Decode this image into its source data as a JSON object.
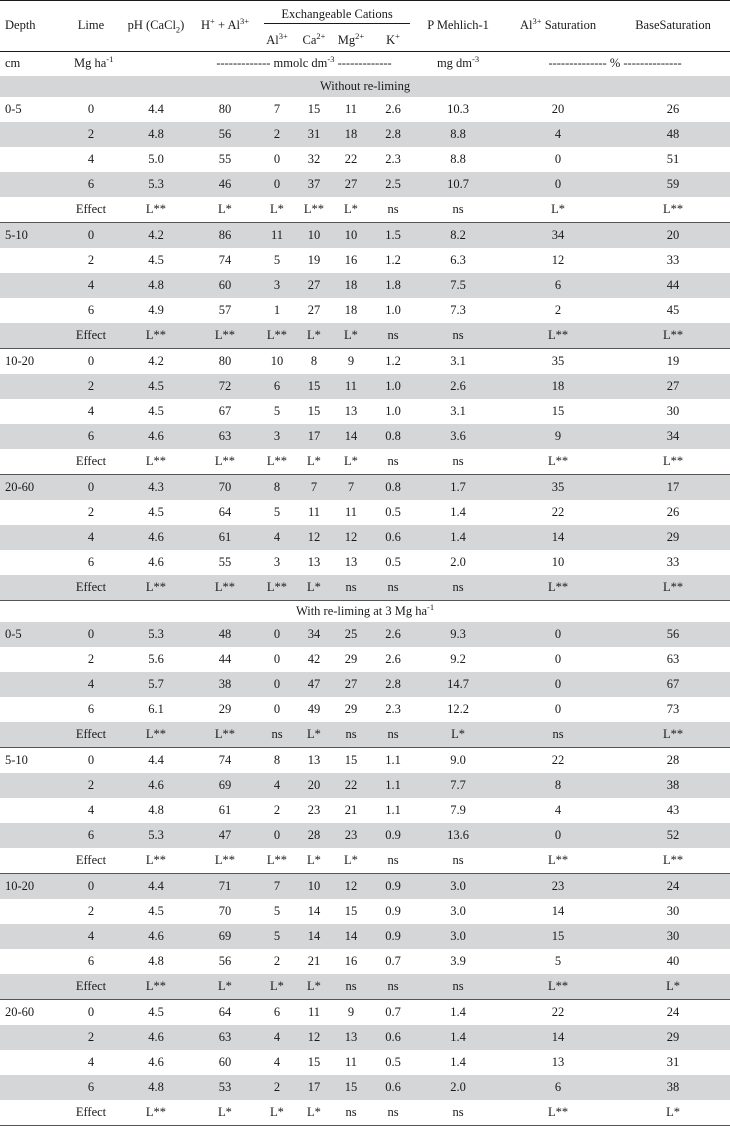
{
  "table": {
    "columns": {
      "depth": "Depth",
      "lime": "Lime",
      "ph": "pH (CaCl",
      "ph_sub": "2",
      "ph_tail": ")",
      "h_al": "H",
      "h_al_sup1": "+",
      "h_al_mid": " + Al",
      "h_al_sup2": "3+",
      "group_exch": "Exchangeable Cations",
      "al": "Al",
      "al_sup": "3+",
      "ca": "Ca",
      "ca_sup": "2+",
      "mg": "Mg",
      "mg_sup": "2+",
      "k": "K",
      "k_sup": "+",
      "p_mehlich": "P Mehlich-1",
      "al_sat": "Al",
      "al_sat_sup": "3+",
      "al_sat_tail": " Saturation",
      "base_sat": "BaseSaturation"
    },
    "units": {
      "depth": "cm",
      "lime": "Mg ha",
      "lime_sup": "-1",
      "cations": "------------- mmolc dm",
      "cations_sup": "-3",
      "cations_tail": " -------------",
      "p": "mg dm",
      "p_sup": "-3",
      "saturation": "-------------- % --------------"
    },
    "sections": [
      {
        "banner": "Without re-liming",
        "banner_sup": "",
        "banner_shaded": true,
        "blocks": [
          {
            "depth": "0-5",
            "rows": [
              {
                "lime": "0",
                "ph": "4.4",
                "h_al": "80",
                "al": "7",
                "ca": "15",
                "mg": "11",
                "k": "2.6",
                "p": "10.3",
                "al_sat": "20",
                "base_sat": "26"
              },
              {
                "lime": "2",
                "ph": "4.8",
                "h_al": "56",
                "al": "2",
                "ca": "31",
                "mg": "18",
                "k": "2.8",
                "p": "8.8",
                "al_sat": "4",
                "base_sat": "48"
              },
              {
                "lime": "4",
                "ph": "5.0",
                "h_al": "55",
                "al": "0",
                "ca": "32",
                "mg": "22",
                "k": "2.3",
                "p": "8.8",
                "al_sat": "0",
                "base_sat": "51"
              },
              {
                "lime": "6",
                "ph": "5.3",
                "h_al": "46",
                "al": "0",
                "ca": "37",
                "mg": "27",
                "k": "2.5",
                "p": "10.7",
                "al_sat": "0",
                "base_sat": "59"
              },
              {
                "lime": "Effect",
                "ph": "L**",
                "h_al": "L*",
                "al": "L*",
                "ca": "L**",
                "mg": "L*",
                "k": "ns",
                "p": "ns",
                "al_sat": "L*",
                "base_sat": "L**"
              }
            ]
          },
          {
            "depth": "5-10",
            "rows": [
              {
                "lime": "0",
                "ph": "4.2",
                "h_al": "86",
                "al": "11",
                "ca": "10",
                "mg": "10",
                "k": "1.5",
                "p": "8.2",
                "al_sat": "34",
                "base_sat": "20"
              },
              {
                "lime": "2",
                "ph": "4.5",
                "h_al": "74",
                "al": "5",
                "ca": "19",
                "mg": "16",
                "k": "1.2",
                "p": "6.3",
                "al_sat": "12",
                "base_sat": "33"
              },
              {
                "lime": "4",
                "ph": "4.8",
                "h_al": "60",
                "al": "3",
                "ca": "27",
                "mg": "18",
                "k": "1.8",
                "p": "7.5",
                "al_sat": "6",
                "base_sat": "44"
              },
              {
                "lime": "6",
                "ph": "4.9",
                "h_al": "57",
                "al": "1",
                "ca": "27",
                "mg": "18",
                "k": "1.0",
                "p": "7.3",
                "al_sat": "2",
                "base_sat": "45"
              },
              {
                "lime": "Effect",
                "ph": "L**",
                "h_al": "L**",
                "al": "L**",
                "ca": "L*",
                "mg": "L*",
                "k": "ns",
                "p": "ns",
                "al_sat": "L**",
                "base_sat": "L**"
              }
            ]
          },
          {
            "depth": "10-20",
            "rows": [
              {
                "lime": "0",
                "ph": "4.2",
                "h_al": "80",
                "al": "10",
                "ca": "8",
                "mg": "9",
                "k": "1.2",
                "p": "3.1",
                "al_sat": "35",
                "base_sat": "19"
              },
              {
                "lime": "2",
                "ph": "4.5",
                "h_al": "72",
                "al": "6",
                "ca": "15",
                "mg": "11",
                "k": "1.0",
                "p": "2.6",
                "al_sat": "18",
                "base_sat": "27"
              },
              {
                "lime": "4",
                "ph": "4.5",
                "h_al": "67",
                "al": "5",
                "ca": "15",
                "mg": "13",
                "k": "1.0",
                "p": "3.1",
                "al_sat": "15",
                "base_sat": "30"
              },
              {
                "lime": "6",
                "ph": "4.6",
                "h_al": "63",
                "al": "3",
                "ca": "17",
                "mg": "14",
                "k": "0.8",
                "p": "3.6",
                "al_sat": "9",
                "base_sat": "34"
              },
              {
                "lime": "Effect",
                "ph": "L**",
                "h_al": "L**",
                "al": "L**",
                "ca": "L*",
                "mg": "L*",
                "k": "ns",
                "p": "ns",
                "al_sat": "L**",
                "base_sat": "L**"
              }
            ]
          },
          {
            "depth": "20-60",
            "rows": [
              {
                "lime": "0",
                "ph": "4.3",
                "h_al": "70",
                "al": "8",
                "ca": "7",
                "mg": "7",
                "k": "0.8",
                "p": "1.7",
                "al_sat": "35",
                "base_sat": "17"
              },
              {
                "lime": "2",
                "ph": "4.5",
                "h_al": "64",
                "al": "5",
                "ca": "11",
                "mg": "11",
                "k": "0.5",
                "p": "1.4",
                "al_sat": "22",
                "base_sat": "26"
              },
              {
                "lime": "4",
                "ph": "4.6",
                "h_al": "61",
                "al": "4",
                "ca": "12",
                "mg": "12",
                "k": "0.6",
                "p": "1.4",
                "al_sat": "14",
                "base_sat": "29"
              },
              {
                "lime": "6",
                "ph": "4.6",
                "h_al": "55",
                "al": "3",
                "ca": "13",
                "mg": "13",
                "k": "0.5",
                "p": "2.0",
                "al_sat": "10",
                "base_sat": "33"
              },
              {
                "lime": "Effect",
                "ph": "L**",
                "h_al": "L**",
                "al": "L**",
                "ca": "L*",
                "mg": "ns",
                "k": "ns",
                "p": "ns",
                "al_sat": "L**",
                "base_sat": "L**"
              }
            ]
          }
        ]
      },
      {
        "banner": "With re-liming at 3 Mg ha",
        "banner_sup": "-1",
        "banner_shaded": false,
        "blocks": [
          {
            "depth": "0-5",
            "rows": [
              {
                "lime": "0",
                "ph": "5.3",
                "h_al": "48",
                "al": "0",
                "ca": "34",
                "mg": "25",
                "k": "2.6",
                "p": "9.3",
                "al_sat": "0",
                "base_sat": "56"
              },
              {
                "lime": "2",
                "ph": "5.6",
                "h_al": "44",
                "al": "0",
                "ca": "42",
                "mg": "29",
                "k": "2.6",
                "p": "9.2",
                "al_sat": "0",
                "base_sat": "63"
              },
              {
                "lime": "4",
                "ph": "5.7",
                "h_al": "38",
                "al": "0",
                "ca": "47",
                "mg": "27",
                "k": "2.8",
                "p": "14.7",
                "al_sat": "0",
                "base_sat": "67"
              },
              {
                "lime": "6",
                "ph": "6.1",
                "h_al": "29",
                "al": "0",
                "ca": "49",
                "mg": "29",
                "k": "2.3",
                "p": "12.2",
                "al_sat": "0",
                "base_sat": "73"
              },
              {
                "lime": "Effect",
                "ph": "L**",
                "h_al": "L**",
                "al": "ns",
                "ca": "L*",
                "mg": "ns",
                "k": "ns",
                "p": "L*",
                "al_sat": "ns",
                "base_sat": "L**"
              }
            ]
          },
          {
            "depth": "5-10",
            "rows": [
              {
                "lime": "0",
                "ph": "4.4",
                "h_al": "74",
                "al": "8",
                "ca": "13",
                "mg": "15",
                "k": "1.1",
                "p": "9.0",
                "al_sat": "22",
                "base_sat": "28"
              },
              {
                "lime": "2",
                "ph": "4.6",
                "h_al": "69",
                "al": "4",
                "ca": "20",
                "mg": "22",
                "k": "1.1",
                "p": "7.7",
                "al_sat": "8",
                "base_sat": "38"
              },
              {
                "lime": "4",
                "ph": "4.8",
                "h_al": "61",
                "al": "2",
                "ca": "23",
                "mg": "21",
                "k": "1.1",
                "p": "7.9",
                "al_sat": "4",
                "base_sat": "43"
              },
              {
                "lime": "6",
                "ph": "5.3",
                "h_al": "47",
                "al": "0",
                "ca": "28",
                "mg": "23",
                "k": "0.9",
                "p": "13.6",
                "al_sat": "0",
                "base_sat": "52"
              },
              {
                "lime": "Effect",
                "ph": "L**",
                "h_al": "L**",
                "al": "L**",
                "ca": "L*",
                "mg": "L*",
                "k": "ns",
                "p": "ns",
                "al_sat": "L**",
                "base_sat": "L**"
              }
            ]
          },
          {
            "depth": "10-20",
            "rows": [
              {
                "lime": "0",
                "ph": "4.4",
                "h_al": "71",
                "al": "7",
                "ca": "10",
                "mg": "12",
                "k": "0.9",
                "p": "3.0",
                "al_sat": "23",
                "base_sat": "24"
              },
              {
                "lime": "2",
                "ph": "4.5",
                "h_al": "70",
                "al": "5",
                "ca": "14",
                "mg": "15",
                "k": "0.9",
                "p": "3.0",
                "al_sat": "14",
                "base_sat": "30"
              },
              {
                "lime": "4",
                "ph": "4.6",
                "h_al": "69",
                "al": "5",
                "ca": "14",
                "mg": "14",
                "k": "0.9",
                "p": "3.0",
                "al_sat": "15",
                "base_sat": "30"
              },
              {
                "lime": "6",
                "ph": "4.8",
                "h_al": "56",
                "al": "2",
                "ca": "21",
                "mg": "16",
                "k": "0.7",
                "p": "3.9",
                "al_sat": "5",
                "base_sat": "40"
              },
              {
                "lime": "Effect",
                "ph": "L**",
                "h_al": "L*",
                "al": "L*",
                "ca": "L*",
                "mg": "ns",
                "k": "ns",
                "p": "ns",
                "al_sat": "L**",
                "base_sat": "L*"
              }
            ]
          },
          {
            "depth": "20-60",
            "rows": [
              {
                "lime": "0",
                "ph": "4.5",
                "h_al": "64",
                "al": "6",
                "ca": "11",
                "mg": "9",
                "k": "0.7",
                "p": "1.4",
                "al_sat": "22",
                "base_sat": "24"
              },
              {
                "lime": "2",
                "ph": "4.6",
                "h_al": "63",
                "al": "4",
                "ca": "12",
                "mg": "13",
                "k": "0.6",
                "p": "1.4",
                "al_sat": "14",
                "base_sat": "29"
              },
              {
                "lime": "4",
                "ph": "4.6",
                "h_al": "60",
                "al": "4",
                "ca": "15",
                "mg": "11",
                "k": "0.5",
                "p": "1.4",
                "al_sat": "13",
                "base_sat": "31"
              },
              {
                "lime": "6",
                "ph": "4.8",
                "h_al": "53",
                "al": "2",
                "ca": "17",
                "mg": "15",
                "k": "0.6",
                "p": "2.0",
                "al_sat": "6",
                "base_sat": "38"
              },
              {
                "lime": "Effect",
                "ph": "L**",
                "h_al": "L*",
                "al": "L*",
                "ca": "L*",
                "mg": "ns",
                "k": "ns",
                "p": "ns",
                "al_sat": "L**",
                "base_sat": "L*"
              }
            ]
          }
        ]
      }
    ]
  },
  "colors": {
    "stripe": "#d4d6d7",
    "text": "#1a1a1a",
    "rule": "#1a1a1a"
  }
}
